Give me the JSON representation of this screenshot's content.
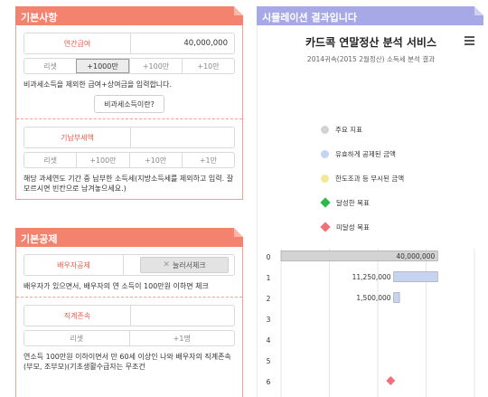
{
  "basic": {
    "title": "기본사항",
    "salary": {
      "label": "연간급여",
      "value": "40,000,000"
    },
    "salary_buttons": [
      "리셋",
      "+1000만",
      "+100만",
      "+10만"
    ],
    "salary_note": "비과세소득을 제외한 급여+상여금을 입력합니다.",
    "help_button": "비과세소득이란?",
    "tax": {
      "label": "기납부세액",
      "value": ""
    },
    "tax_buttons": [
      "리셋",
      "+100만",
      "+10만",
      "+1만"
    ],
    "tax_note": "해당 과세연도 기간 중 납부한 소득세(지방소득세를 제외하고 입력. 잘 모르시면 빈칸으로 남겨놓으세요.)"
  },
  "deduction": {
    "title": "기본공제",
    "spouse": {
      "label": "배우자공제",
      "toggle": "눌러서체크"
    },
    "spouse_note": "배우자가 있으면서, 배우자의 연 소득이 100만원 이하면 체크",
    "lineal": {
      "label": "직계존속",
      "value": ""
    },
    "lineal_buttons": [
      "리셋",
      "+1명"
    ],
    "lineal_note": "연소득 100만원 이하이면서 만 60세 이상인 나와 배우자의 직계존속(부모, 조부모)(기초생활수급자는 무조건"
  },
  "result": {
    "title": "시뮬레이션 결과입니다",
    "chart_title": "카드콕 연말정산 분석 서비스",
    "chart_subtitle": "2014귀속(2015 2월정산) 소득세 분석 결과",
    "legend": [
      {
        "label": "주요 지표",
        "color": "#d3d3d3",
        "shape": "circle"
      },
      {
        "label": "유효하게 공제된 금액",
        "color": "#c6d4f2",
        "shape": "circle"
      },
      {
        "label": "한도조과 등 무시된 금액",
        "color": "#f3e79a",
        "shape": "circle"
      },
      {
        "label": "달성한 목표",
        "color": "#2fb84a",
        "shape": "diamond"
      },
      {
        "label": "미달성 목표",
        "color": "#ef6f7a",
        "shape": "diamond"
      }
    ]
  },
  "chart_data": {
    "type": "bar",
    "orientation": "horizontal-floating",
    "categories": [
      "0",
      "1",
      "2",
      "3",
      "4",
      "5",
      "6"
    ],
    "bars": [
      {
        "category": "0",
        "start": 0,
        "end": 40000000,
        "label": "40,000,000",
        "color": "#d3d3d3"
      },
      {
        "category": "1",
        "start": 28750000,
        "end": 40000000,
        "label": "11,250,000",
        "color": "#c6d4f2"
      },
      {
        "category": "2",
        "start": 28750000,
        "end": 30250000,
        "label": "1,500,000",
        "color": "#c6d4f2"
      }
    ],
    "markers": [
      {
        "category": "6",
        "value": 28000000,
        "shape": "diamond",
        "color": "#ef6f7a"
      }
    ],
    "xlim": [
      0,
      42000000
    ]
  }
}
